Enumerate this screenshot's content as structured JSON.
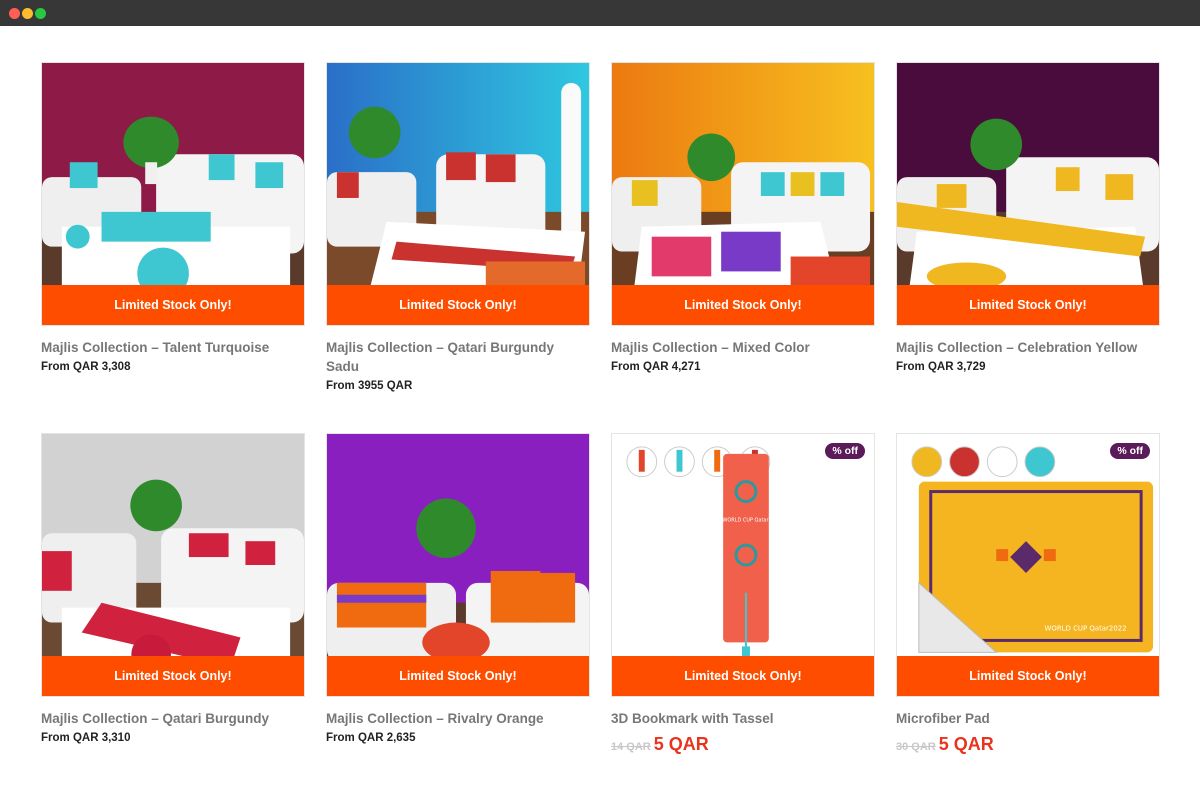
{
  "stock_label": "Limited Stock Only!",
  "discount_badge": "% off",
  "products": [
    {
      "name": "Majlis Collection – Talent Turquoise",
      "price": "From QAR 3,308",
      "wall": "#8e1a47",
      "accent": "#3ec7d0"
    },
    {
      "name": "Majlis Collection – Qatari Burgundy Sadu",
      "price": "From 3955 QAR",
      "wall": "#2f8fd8",
      "accent": "#c9322f"
    },
    {
      "name": "Majlis Collection – Mixed Color",
      "price": "From QAR 4,271",
      "wall": "#f0a010",
      "accent": "#e8c020"
    },
    {
      "name": "Majlis Collection – Celebration Yellow",
      "price": "From QAR 3,729",
      "wall": "#4a0c3c",
      "accent": "#f0b820"
    },
    {
      "name": "Majlis Collection – Qatari Burgundy",
      "price": "From QAR 3,310",
      "wall": "#cfcfcf",
      "accent": "#d0213e"
    },
    {
      "name": "Majlis Collection – Rivalry Orange",
      "price": "From QAR 2,635",
      "wall": "#8a1fc0",
      "accent": "#f06a10"
    },
    {
      "name": "3D Bookmark with Tassel",
      "old_price": "14 QAR",
      "new_price": "5 QAR"
    },
    {
      "name": "Microfiber Pad",
      "old_price": "30 QAR",
      "new_price": "5 QAR"
    }
  ],
  "bookmark_text": "FIFA WORLD CUP Qatar2022",
  "pad_text": "WORLD CUP Qatar2022"
}
